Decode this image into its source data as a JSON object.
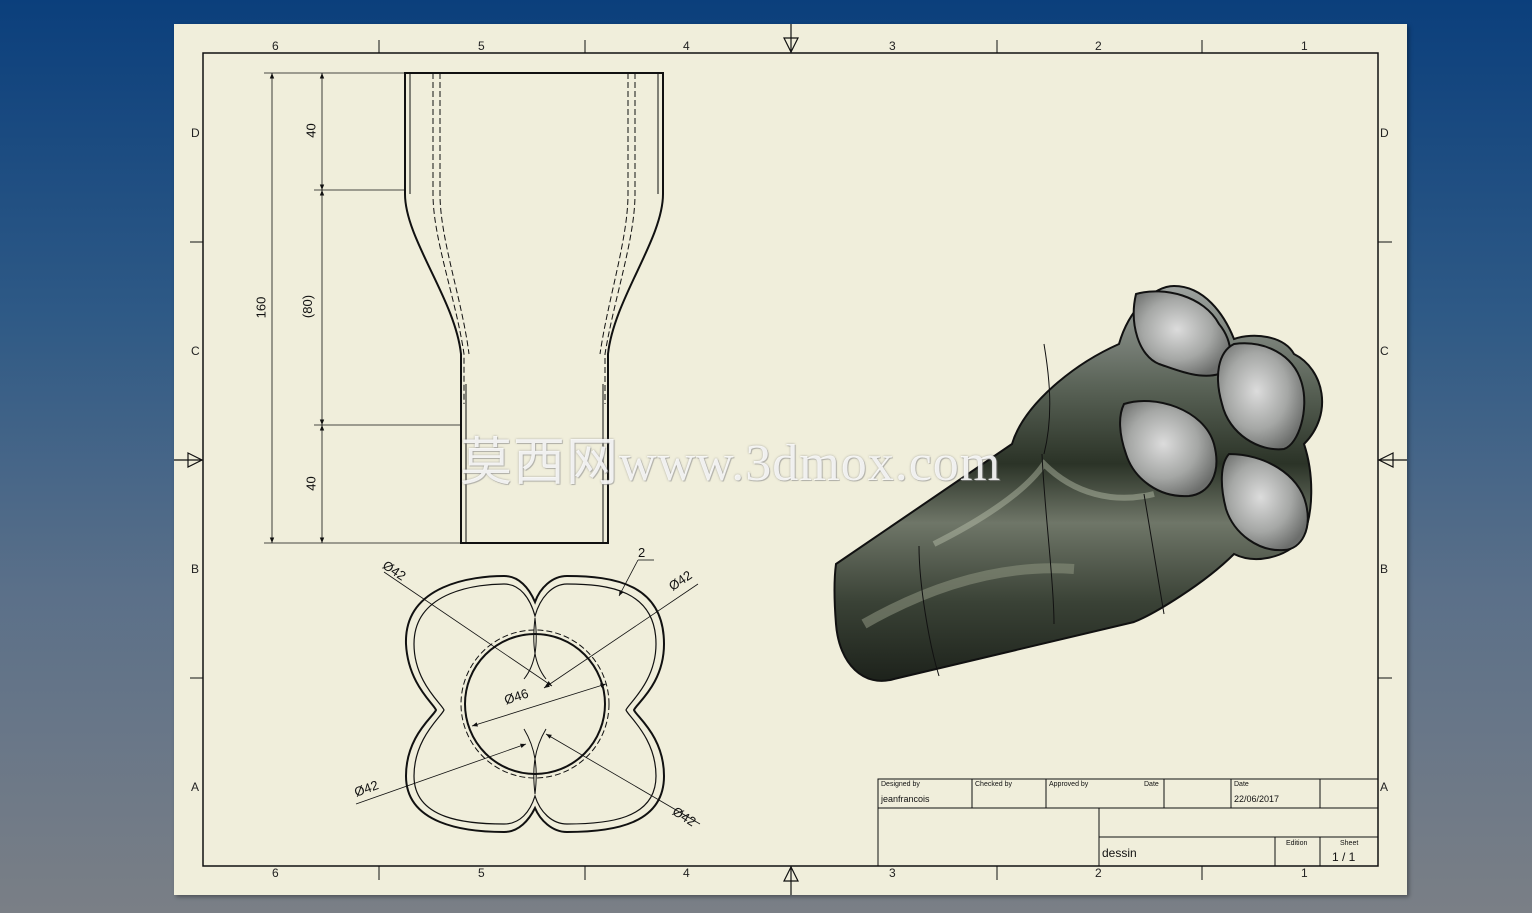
{
  "sheet": {
    "columns_top": [
      "6",
      "5",
      "4",
      "3",
      "2",
      "1"
    ],
    "columns_bottom": [
      "6",
      "5",
      "4",
      "3",
      "2",
      "1"
    ],
    "rows_left": [
      "D",
      "C",
      "B",
      "A"
    ],
    "rows_right": [
      "D",
      "C",
      "B",
      "A"
    ]
  },
  "front_view": {
    "dim_total": "160",
    "dim_top": "40",
    "dim_mid": "(80)",
    "dim_bottom": "40"
  },
  "top_view": {
    "dia_top_left": "Ø42",
    "dia_top_right": "Ø42",
    "dia_bottom_left": "Ø42",
    "dia_bottom_right": "Ø42",
    "dia_center": "Ø46",
    "thickness": "2"
  },
  "title_block": {
    "designed_by_label": "Designed by",
    "designed_by_value": "jeanfrancois",
    "checked_by_label": "Checked by",
    "approved_by_label": "Approved by",
    "date_label_1": "Date",
    "date_label_2": "Date",
    "date_value": "22/06/2017",
    "title_value": "dessin",
    "edition_label": "Edition",
    "sheet_label": "Sheet",
    "sheet_value": "1 / 1"
  },
  "watermark": "莫西网www.3dmox.com",
  "colors": {
    "sheet_background": "#f0eedb",
    "line": "#111111",
    "window_background_top": "#0b3f7c",
    "window_background_bottom": "#7a7f86"
  }
}
